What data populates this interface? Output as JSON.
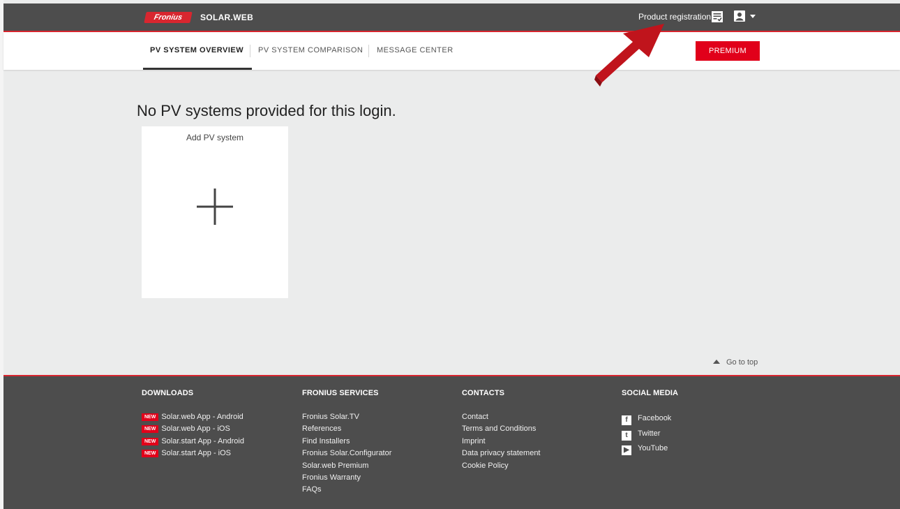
{
  "header": {
    "logo_text": "Fronius",
    "brand": "SOLAR.WEB",
    "product_registration": "Product registration"
  },
  "tabs": [
    {
      "label": "PV SYSTEM OVERVIEW",
      "active": true
    },
    {
      "label": "PV SYSTEM COMPARISON",
      "active": false
    },
    {
      "label": "MESSAGE CENTER",
      "active": false
    }
  ],
  "premium_label": "PREMIUM",
  "main": {
    "heading": "No PV systems provided for this login.",
    "add_card_title": "Add PV system",
    "go_to_top": "Go to top"
  },
  "footer": {
    "downloads": {
      "title": "DOWNLOADS",
      "badge": "NEW",
      "items": [
        "Solar.web App - Android",
        "Solar.web App - iOS",
        "Solar.start App - Android",
        "Solar.start App - iOS"
      ]
    },
    "services": {
      "title": "FRONIUS SERVICES",
      "items": [
        "Fronius Solar.TV",
        "References",
        "Find Installers",
        "Fronius Solar.Configurator",
        "Solar.web Premium",
        "Fronius Warranty",
        "FAQs"
      ]
    },
    "contacts": {
      "title": "CONTACTS",
      "items": [
        "Contact",
        "Terms and Conditions",
        "Imprint",
        "Data privacy statement",
        "Cookie Policy"
      ]
    },
    "social": {
      "title": "SOCIAL MEDIA",
      "items": [
        {
          "label": "Facebook",
          "icon": "facebook-icon"
        },
        {
          "label": "Twitter",
          "icon": "twitter-icon"
        },
        {
          "label": "YouTube",
          "icon": "youtube-icon"
        }
      ]
    }
  },
  "colors": {
    "brand_red": "#e1001a",
    "header_bg": "#4d4d4d",
    "page_bg": "#ebecec",
    "annotation_arrow": "#c0141c"
  }
}
